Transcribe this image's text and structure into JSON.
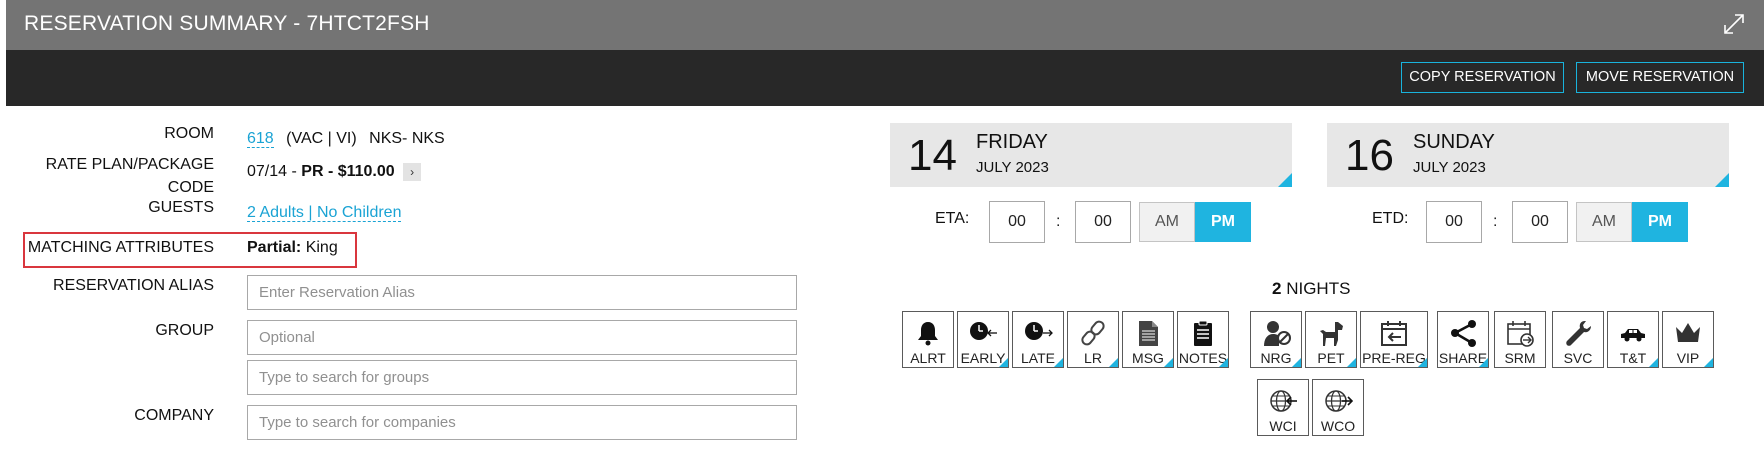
{
  "window": {
    "title": "RESERVATION SUMMARY - 7HTCT2FSH",
    "expand_icon": "expand-icon"
  },
  "toolbar": {
    "copy_label": "COPY RESERVATION",
    "move_label": "MOVE RESERVATION"
  },
  "details": {
    "room_label": "ROOM",
    "room_number": "618",
    "room_status": "(VAC | VI)",
    "room_type": "NKS- NKS",
    "rate_label_line1": "RATE PLAN/PACKAGE",
    "rate_label_line2": "CODE",
    "rate_date": "07/14 - ",
    "rate_value": "PR - $110.00",
    "rate_arrow": "›",
    "guests_label": "GUESTS",
    "guests_value": "2 Adults | No Children",
    "matching_label": "MATCHING ATTRIBUTES",
    "matching_prefix": "Partial:",
    "matching_value": " King",
    "alias_label": "RESERVATION ALIAS",
    "alias_placeholder": "Enter Reservation Alias",
    "group_label": "GROUP",
    "group_placeholder": "Optional",
    "group_search_placeholder": "Type to search for groups",
    "company_label": "COMPANY",
    "company_placeholder": "Type to search for companies"
  },
  "arrival": {
    "day": "14",
    "weekday": "FRIDAY",
    "month_year": "JULY 2023",
    "time_label": "ETA:",
    "hour": "00",
    "minute": "00",
    "am": "AM",
    "pm": "PM",
    "selected": "PM"
  },
  "departure": {
    "day": "16",
    "weekday": "SUNDAY",
    "month_year": "JULY 2023",
    "time_label": "ETD:",
    "hour": "00",
    "minute": "00",
    "am": "AM",
    "pm": "PM",
    "selected": "PM"
  },
  "stay": {
    "nights_count": "2",
    "nights_label": " NIGHTS"
  },
  "icon_buttons": [
    {
      "label": "ALRT",
      "icon": "bell-icon",
      "corner": false
    },
    {
      "label": "EARLY",
      "icon": "early-checkin-icon",
      "corner": true
    },
    {
      "label": "LATE",
      "icon": "late-checkout-icon",
      "corner": true
    },
    {
      "label": "LR",
      "icon": "link-icon",
      "corner": true
    },
    {
      "label": "MSG",
      "icon": "message-icon",
      "corner": true
    },
    {
      "label": "NOTES",
      "icon": "notes-icon",
      "corner": true
    },
    {
      "label": "NRG",
      "icon": "no-guest-icon",
      "corner": true
    },
    {
      "label": "PET",
      "icon": "pet-icon",
      "corner": true
    },
    {
      "label": "PRE-REG",
      "icon": "pre-register-icon",
      "corner": true
    },
    {
      "label": "SHARE",
      "icon": "share-icon",
      "corner": true
    },
    {
      "label": "SRM",
      "icon": "srm-calendar-icon",
      "corner": false
    },
    {
      "label": "SVC",
      "icon": "wrench-icon",
      "corner": false
    },
    {
      "label": "T&T",
      "icon": "car-icon",
      "corner": true
    },
    {
      "label": "VIP",
      "icon": "crown-icon",
      "corner": true
    },
    {
      "label": "WCI",
      "icon": "web-checkin-icon",
      "corner": false
    },
    {
      "label": "WCO",
      "icon": "web-checkout-icon",
      "corner": false
    }
  ],
  "colors": {
    "accent": "#1fb4e0",
    "title_bar": "#747474",
    "toolbar": "#282828",
    "highlight": "#d9363e"
  }
}
